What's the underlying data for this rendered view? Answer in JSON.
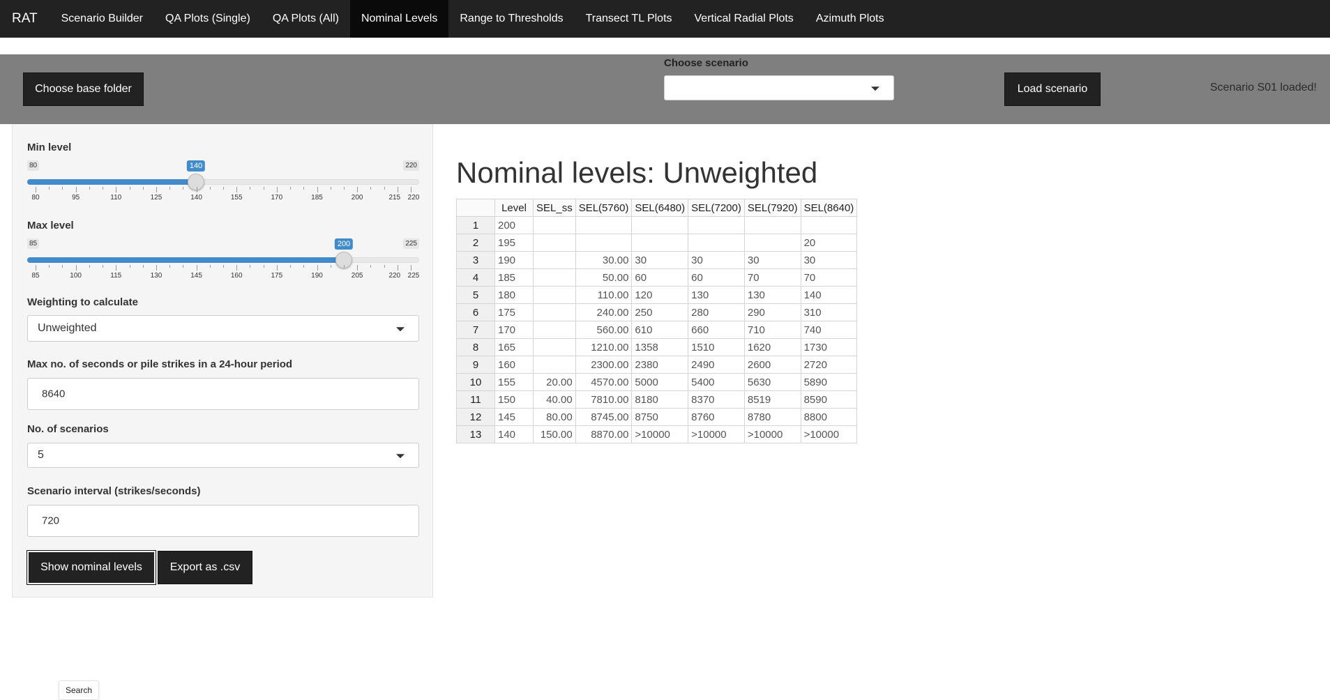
{
  "navbar": {
    "brand": "RAT",
    "items": [
      {
        "label": "Scenario Builder"
      },
      {
        "label": "QA Plots (Single)"
      },
      {
        "label": "QA Plots (All)"
      },
      {
        "label": "Nominal Levels",
        "active": true
      },
      {
        "label": "Range to Thresholds"
      },
      {
        "label": "Transect TL Plots"
      },
      {
        "label": "Vertical Radial Plots"
      },
      {
        "label": "Azimuth Plots"
      }
    ]
  },
  "topbar": {
    "base_folder_button": "Choose base folder",
    "choose_scenario_label": "Choose scenario",
    "scenario_value": "",
    "load_button": "Load scenario",
    "status": "Scenario S01 loaded!"
  },
  "sidebar": {
    "min_level": {
      "label": "Min level",
      "min": "80",
      "max": "220",
      "value": "140",
      "ticks": [
        "80",
        "95",
        "110",
        "125",
        "140",
        "155",
        "170",
        "185",
        "200",
        "215",
        "220"
      ]
    },
    "max_level": {
      "label": "Max level",
      "min": "85",
      "max": "225",
      "value": "200",
      "ticks": [
        "85",
        "100",
        "115",
        "130",
        "145",
        "160",
        "175",
        "190",
        "205",
        "220",
        "225"
      ]
    },
    "weighting": {
      "label": "Weighting to calculate",
      "value": "Unweighted"
    },
    "max_seconds": {
      "label": "Max no. of seconds or pile strikes in a 24-hour period",
      "value": "8640"
    },
    "num_scenarios": {
      "label": "No. of scenarios",
      "value": "5"
    },
    "interval": {
      "label": "Scenario interval (strikes/seconds)",
      "value": "720"
    },
    "show_button": "Show nominal levels",
    "export_button": "Export as .csv"
  },
  "main": {
    "title": "Nominal levels: Unweighted",
    "table": {
      "headers": [
        "",
        "Level",
        "SEL_ss",
        "SEL(5760)",
        "SEL(6480)",
        "SEL(7200)",
        "SEL(7920)",
        "SEL(8640)"
      ],
      "rows": [
        [
          "1",
          "200",
          "",
          "",
          "",
          "",
          "",
          ""
        ],
        [
          "2",
          "195",
          "",
          "",
          "",
          "",
          "",
          "20"
        ],
        [
          "3",
          "190",
          "",
          "30.00",
          "30",
          "30",
          "30",
          "30"
        ],
        [
          "4",
          "185",
          "",
          "50.00",
          "60",
          "60",
          "70",
          "70"
        ],
        [
          "5",
          "180",
          "",
          "110.00",
          "120",
          "130",
          "130",
          "140"
        ],
        [
          "6",
          "175",
          "",
          "240.00",
          "250",
          "280",
          "290",
          "310"
        ],
        [
          "7",
          "170",
          "",
          "560.00",
          "610",
          "660",
          "710",
          "740"
        ],
        [
          "8",
          "165",
          "",
          "1210.00",
          "1358",
          "1510",
          "1620",
          "1730"
        ],
        [
          "9",
          "160",
          "",
          "2300.00",
          "2380",
          "2490",
          "2600",
          "2720"
        ],
        [
          "10",
          "155",
          "20.00",
          "4570.00",
          "5000",
          "5400",
          "5630",
          "5890"
        ],
        [
          "11",
          "150",
          "40.00",
          "7810.00",
          "8180",
          "8370",
          "8519",
          "8590"
        ],
        [
          "12",
          "145",
          "80.00",
          "8745.00",
          "8750",
          "8760",
          "8780",
          "8800"
        ],
        [
          "13",
          "140",
          "150.00",
          "8870.00",
          ">10000",
          ">10000",
          ">10000",
          ">10000"
        ]
      ]
    }
  },
  "footer": {
    "search_tooltip": "Search"
  }
}
